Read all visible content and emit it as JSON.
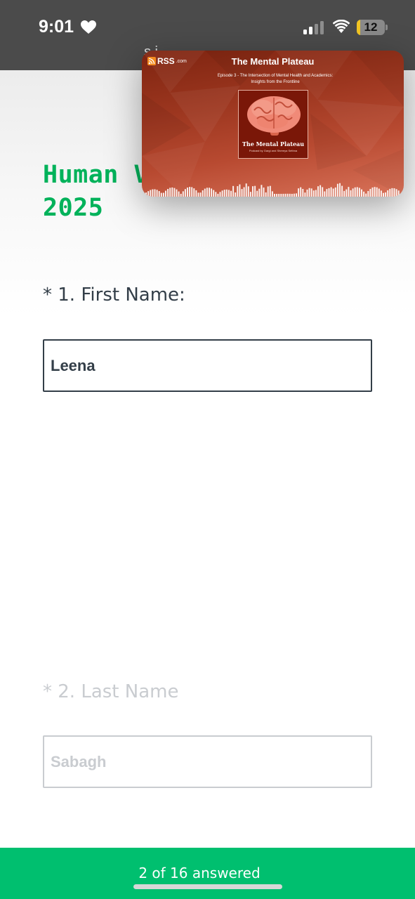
{
  "status_bar": {
    "time": "9:01",
    "battery_level": "12",
    "battery_fraction": 0.12,
    "behind_text": "s           i"
  },
  "survey": {
    "title": "Human VOICES Survey 2025",
    "questions": [
      {
        "label": "* 1. First Name:",
        "value": "Leena"
      },
      {
        "label": "* 2. Last Name",
        "value": "Sabagh"
      }
    ]
  },
  "footer": {
    "progress_text": "2 of 16 answered",
    "answered": 2,
    "total": 16
  },
  "pip": {
    "brand": "RSS",
    "brand_suffix": ".com",
    "title": "The Mental Plateau",
    "episode": "Episode 3 - The Intersection of Mental Health and Academics: Insights from the Frontline",
    "art_title": "The Mental Plateau",
    "art_subtitle": "Podcast by Gargi and Shreeya Sethna"
  },
  "icons": [
    "heart-icon",
    "signal-icon",
    "wifi-icon",
    "battery-icon",
    "rss-icon",
    "brain-icon",
    "waveform-icon"
  ],
  "colors": {
    "accent_green": "#00b25a",
    "footer_green": "#00bf6f",
    "text_dark": "#333e48",
    "text_faded": "#c9ccd0",
    "status_bar": "#4b4b4b",
    "battery_yellow": "#f3c623",
    "podcast_red": "#9c361f"
  }
}
